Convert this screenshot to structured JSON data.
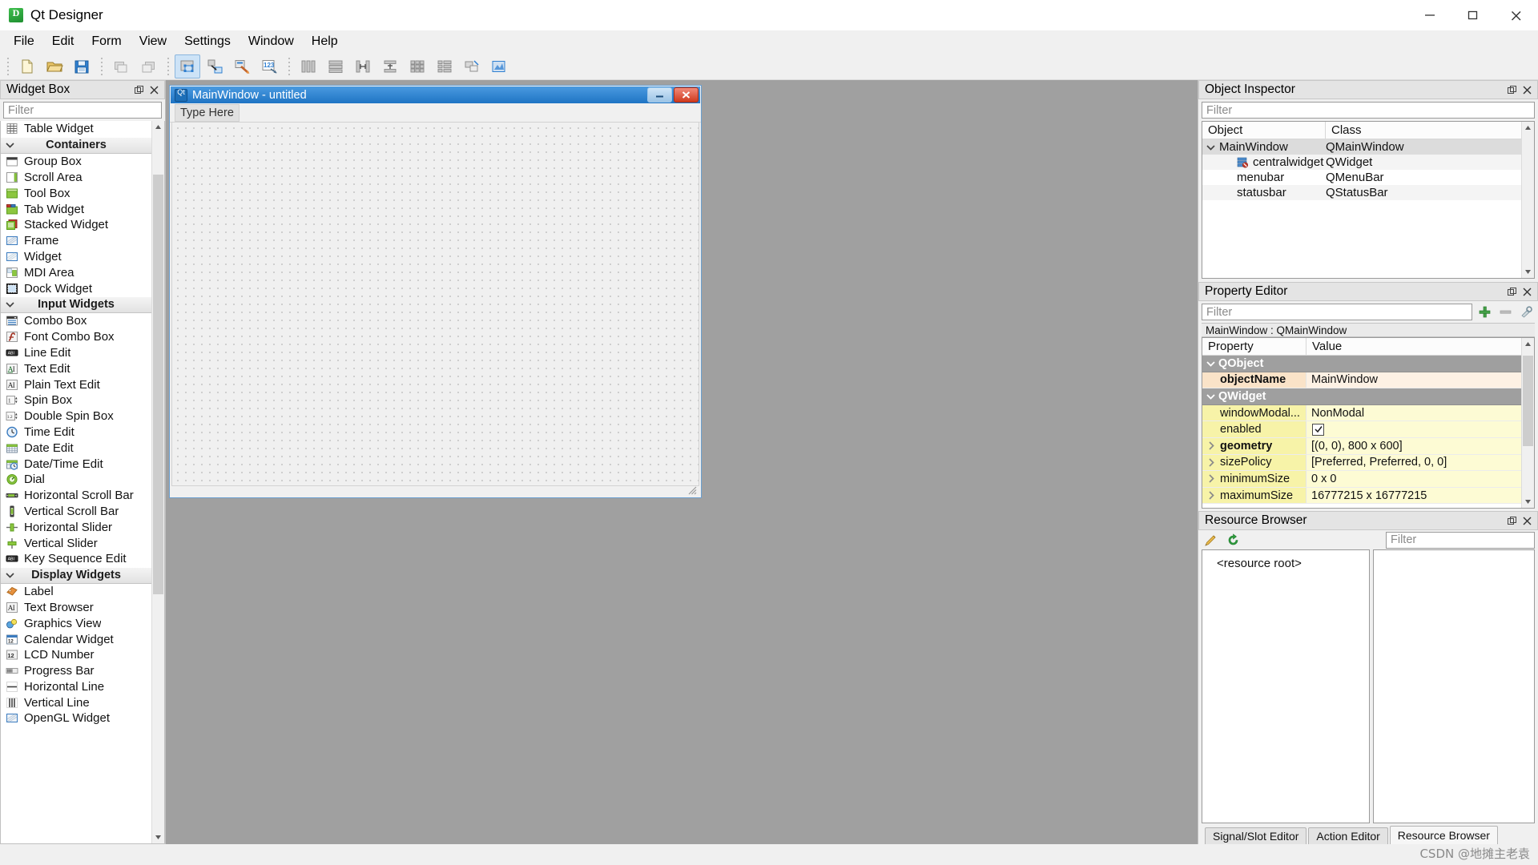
{
  "window": {
    "app_title": "Qt Designer",
    "app_icon": "qt-designer-icon",
    "controls": {
      "minimize": "minimize-icon",
      "maximize": "maximize-icon",
      "close": "close-icon"
    }
  },
  "menubar": {
    "items": [
      "File",
      "Edit",
      "Form",
      "View",
      "Settings",
      "Window",
      "Help"
    ]
  },
  "toolbar": {
    "groups": [
      {
        "buttons": [
          {
            "name": "new-form-button",
            "icon": "new-document-icon",
            "active": false
          },
          {
            "name": "open-form-button",
            "icon": "open-folder-icon",
            "active": false
          },
          {
            "name": "save-form-button",
            "icon": "save-disk-icon",
            "active": false
          }
        ]
      },
      {
        "buttons": [
          {
            "name": "undo-button",
            "icon": "undo-icon",
            "active": false
          },
          {
            "name": "redo-button",
            "icon": "redo-icon",
            "active": false
          }
        ]
      },
      {
        "buttons": [
          {
            "name": "edit-widgets-button",
            "icon": "edit-widgets-icon",
            "active": true
          },
          {
            "name": "edit-signals-slots-button",
            "icon": "signals-slots-icon",
            "active": false
          },
          {
            "name": "edit-buddies-button",
            "icon": "edit-buddies-icon",
            "active": false
          },
          {
            "name": "edit-tab-order-button",
            "icon": "tab-order-icon",
            "active": false
          }
        ]
      },
      {
        "buttons": [
          {
            "name": "layout-horizontally-button",
            "icon": "layout-horizontal-icon",
            "active": false
          },
          {
            "name": "layout-vertically-button",
            "icon": "layout-vertical-icon",
            "active": false
          },
          {
            "name": "layout-splitter-horizontal-button",
            "icon": "splitter-horizontal-icon",
            "active": false
          },
          {
            "name": "layout-splitter-vertical-button",
            "icon": "splitter-vertical-icon",
            "active": false
          },
          {
            "name": "layout-grid-button",
            "icon": "layout-grid-icon",
            "active": false
          },
          {
            "name": "layout-form-button",
            "icon": "layout-form-icon",
            "active": false
          },
          {
            "name": "break-layout-button",
            "icon": "break-layout-icon",
            "active": false
          },
          {
            "name": "adjust-size-button",
            "icon": "adjust-size-icon",
            "active": false
          }
        ]
      }
    ]
  },
  "widget_box": {
    "title": "Widget Box",
    "filter_placeholder": "Filter",
    "filter_value": "",
    "undock_icon": "undock-icon",
    "close_icon": "close-icon",
    "rows": [
      {
        "type": "item",
        "label": "Table Widget",
        "icon": "table-widget-icon"
      },
      {
        "type": "category",
        "label": "Containers"
      },
      {
        "type": "item",
        "label": "Group Box",
        "icon": "group-box-icon"
      },
      {
        "type": "item",
        "label": "Scroll Area",
        "icon": "scroll-area-icon"
      },
      {
        "type": "item",
        "label": "Tool Box",
        "icon": "tool-box-icon"
      },
      {
        "type": "item",
        "label": "Tab Widget",
        "icon": "tab-widget-icon"
      },
      {
        "type": "item",
        "label": "Stacked Widget",
        "icon": "stacked-widget-icon"
      },
      {
        "type": "item",
        "label": "Frame",
        "icon": "frame-icon"
      },
      {
        "type": "item",
        "label": "Widget",
        "icon": "widget-icon"
      },
      {
        "type": "item",
        "label": "MDI Area",
        "icon": "mdi-area-icon"
      },
      {
        "type": "item",
        "label": "Dock Widget",
        "icon": "dock-widget-icon"
      },
      {
        "type": "category",
        "label": "Input Widgets"
      },
      {
        "type": "item",
        "label": "Combo Box",
        "icon": "combo-box-icon"
      },
      {
        "type": "item",
        "label": "Font Combo Box",
        "icon": "font-combo-box-icon"
      },
      {
        "type": "item",
        "label": "Line Edit",
        "icon": "line-edit-icon"
      },
      {
        "type": "item",
        "label": "Text Edit",
        "icon": "text-edit-icon"
      },
      {
        "type": "item",
        "label": "Plain Text Edit",
        "icon": "plain-text-edit-icon"
      },
      {
        "type": "item",
        "label": "Spin Box",
        "icon": "spin-box-icon"
      },
      {
        "type": "item",
        "label": "Double Spin Box",
        "icon": "double-spin-box-icon"
      },
      {
        "type": "item",
        "label": "Time Edit",
        "icon": "time-edit-icon"
      },
      {
        "type": "item",
        "label": "Date Edit",
        "icon": "date-edit-icon"
      },
      {
        "type": "item",
        "label": "Date/Time Edit",
        "icon": "date-time-edit-icon"
      },
      {
        "type": "item",
        "label": "Dial",
        "icon": "dial-icon"
      },
      {
        "type": "item",
        "label": "Horizontal Scroll Bar",
        "icon": "horizontal-scroll-bar-icon"
      },
      {
        "type": "item",
        "label": "Vertical Scroll Bar",
        "icon": "vertical-scroll-bar-icon"
      },
      {
        "type": "item",
        "label": "Horizontal Slider",
        "icon": "horizontal-slider-icon"
      },
      {
        "type": "item",
        "label": "Vertical Slider",
        "icon": "vertical-slider-icon"
      },
      {
        "type": "item",
        "label": "Key Sequence Edit",
        "icon": "key-sequence-edit-icon"
      },
      {
        "type": "category",
        "label": "Display Widgets"
      },
      {
        "type": "item",
        "label": "Label",
        "icon": "label-icon"
      },
      {
        "type": "item",
        "label": "Text Browser",
        "icon": "text-browser-icon"
      },
      {
        "type": "item",
        "label": "Graphics View",
        "icon": "graphics-view-icon"
      },
      {
        "type": "item",
        "label": "Calendar Widget",
        "icon": "calendar-widget-icon"
      },
      {
        "type": "item",
        "label": "LCD Number",
        "icon": "lcd-number-icon"
      },
      {
        "type": "item",
        "label": "Progress Bar",
        "icon": "progress-bar-icon"
      },
      {
        "type": "item",
        "label": "Horizontal Line",
        "icon": "horizontal-line-icon"
      },
      {
        "type": "item",
        "label": "Vertical Line",
        "icon": "vertical-line-icon"
      },
      {
        "type": "item",
        "label": "OpenGL Widget",
        "icon": "opengl-widget-icon"
      }
    ]
  },
  "form": {
    "title": "MainWindow - untitled",
    "icon": "qt-icon",
    "menu_placeholder": "Type Here",
    "buttons": {
      "minimize": "minimize-icon",
      "close": "close-icon"
    }
  },
  "object_inspector": {
    "title": "Object Inspector",
    "filter_placeholder": "Filter",
    "filter_value": "",
    "columns": [
      "Object",
      "Class"
    ],
    "rows": [
      {
        "object": "MainWindow",
        "class": "QMainWindow",
        "depth": 0,
        "expanded": true,
        "selected": true,
        "icon": ""
      },
      {
        "object": "centralwidget",
        "class": "QWidget",
        "depth": 1,
        "expanded": false,
        "selected": false,
        "icon": "central-widget-icon"
      },
      {
        "object": "menubar",
        "class": "QMenuBar",
        "depth": 1,
        "expanded": false,
        "selected": false,
        "icon": ""
      },
      {
        "object": "statusbar",
        "class": "QStatusBar",
        "depth": 1,
        "expanded": false,
        "selected": false,
        "icon": ""
      }
    ]
  },
  "property_editor": {
    "title": "Property Editor",
    "filter_placeholder": "Filter",
    "filter_value": "",
    "object_label": "MainWindow : QMainWindow",
    "tools": [
      {
        "name": "add-dynamic-property-button",
        "icon": "plus-icon"
      },
      {
        "name": "remove-dynamic-property-button",
        "icon": "minus-icon"
      },
      {
        "name": "configure-property-editor-button",
        "icon": "wrench-icon"
      }
    ],
    "columns": [
      "Property",
      "Value"
    ],
    "rows": [
      {
        "kind": "group",
        "property": "QObject",
        "value": "",
        "expanded": true
      },
      {
        "kind": "prop",
        "property": "objectName",
        "value": "MainWindow",
        "tone": "orange",
        "bold": true,
        "expandable": false,
        "checkbox": false
      },
      {
        "kind": "group",
        "property": "QWidget",
        "value": "",
        "expanded": true
      },
      {
        "kind": "prop",
        "property": "windowModal...",
        "value": "NonModal",
        "tone": "yellow",
        "bold": false,
        "expandable": false,
        "checkbox": false
      },
      {
        "kind": "prop",
        "property": "enabled",
        "value": "",
        "tone": "yellow",
        "bold": false,
        "expandable": false,
        "checkbox": true,
        "checked": true
      },
      {
        "kind": "prop",
        "property": "geometry",
        "value": "[(0, 0), 800 x 600]",
        "tone": "yellow",
        "bold": true,
        "expandable": true,
        "checkbox": false
      },
      {
        "kind": "prop",
        "property": "sizePolicy",
        "value": "[Preferred, Preferred, 0, 0]",
        "tone": "yellow",
        "bold": false,
        "expandable": true,
        "checkbox": false
      },
      {
        "kind": "prop",
        "property": "minimumSize",
        "value": "0 x 0",
        "tone": "yellow",
        "bold": false,
        "expandable": true,
        "checkbox": false
      },
      {
        "kind": "prop",
        "property": "maximumSize",
        "value": "16777215 x 16777215",
        "tone": "yellow",
        "bold": false,
        "expandable": true,
        "checkbox": false
      }
    ]
  },
  "resource_browser": {
    "title": "Resource Browser",
    "filter_placeholder": "Filter",
    "filter_value": "",
    "tools": [
      {
        "name": "edit-resources-button",
        "icon": "pencil-icon"
      },
      {
        "name": "reload-resources-button",
        "icon": "reload-icon"
      }
    ],
    "root_label": "<resource root>"
  },
  "bottom_tabs": {
    "tabs": [
      {
        "label": "Signal/Slot Editor",
        "active": false
      },
      {
        "label": "Action Editor",
        "active": false
      },
      {
        "label": "Resource Browser",
        "active": true
      }
    ]
  },
  "watermark": {
    "text": "CSDN @地摊主老袁"
  },
  "colors": {
    "accent_blue": "#2f7fd0",
    "panel_bg": "#f0f0f0",
    "canvas_bg": "#a0a0a0",
    "group_row": "#9f9f9f",
    "prop_orange": "#fae3c8",
    "prop_yellow": "#f7f3a8"
  }
}
